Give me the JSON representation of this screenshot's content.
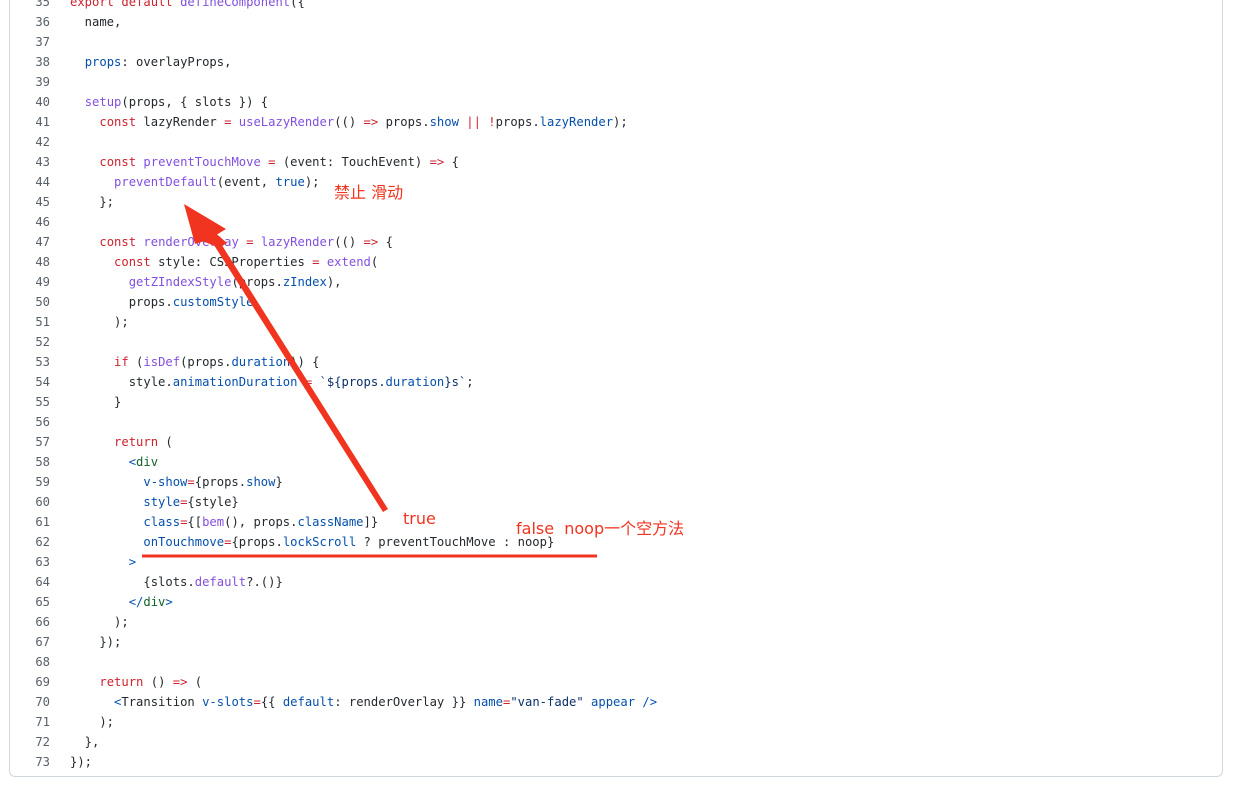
{
  "code": {
    "lines": [
      {
        "n": "35",
        "tokens": [
          {
            "t": "export default ",
            "c": "k"
          },
          {
            "t": "defineComponent",
            "c": "f"
          },
          {
            "t": "({",
            "c": "p"
          }
        ]
      },
      {
        "n": "36",
        "tokens": [
          {
            "t": "  name,",
            "c": "p"
          }
        ]
      },
      {
        "n": "37",
        "tokens": []
      },
      {
        "n": "38",
        "tokens": [
          {
            "t": "  ",
            "c": "p"
          },
          {
            "t": "props",
            "c": "c"
          },
          {
            "t": ": overlayProps,",
            "c": "p"
          }
        ]
      },
      {
        "n": "39",
        "tokens": []
      },
      {
        "n": "40",
        "tokens": [
          {
            "t": "  ",
            "c": "p"
          },
          {
            "t": "setup",
            "c": "f"
          },
          {
            "t": "(props, { slots }) {",
            "c": "p"
          }
        ]
      },
      {
        "n": "41",
        "tokens": [
          {
            "t": "    ",
            "c": "p"
          },
          {
            "t": "const ",
            "c": "k"
          },
          {
            "t": "lazyRender ",
            "c": "p"
          },
          {
            "t": "= ",
            "c": "k"
          },
          {
            "t": "useLazyRender",
            "c": "f"
          },
          {
            "t": "(() ",
            "c": "p"
          },
          {
            "t": "=> ",
            "c": "k"
          },
          {
            "t": "props.",
            "c": "p"
          },
          {
            "t": "show ",
            "c": "c"
          },
          {
            "t": "|| ",
            "c": "k"
          },
          {
            "t": "!",
            "c": "k"
          },
          {
            "t": "props.",
            "c": "p"
          },
          {
            "t": "lazyRender",
            "c": "c"
          },
          {
            "t": ");",
            "c": "p"
          }
        ]
      },
      {
        "n": "42",
        "tokens": []
      },
      {
        "n": "43",
        "tokens": [
          {
            "t": "    ",
            "c": "p"
          },
          {
            "t": "const ",
            "c": "k"
          },
          {
            "t": "preventTouchMove ",
            "c": "f"
          },
          {
            "t": "= ",
            "c": "k"
          },
          {
            "t": "(event: TouchEvent) ",
            "c": "p"
          },
          {
            "t": "=> ",
            "c": "k"
          },
          {
            "t": "{",
            "c": "p"
          }
        ]
      },
      {
        "n": "44",
        "tokens": [
          {
            "t": "      ",
            "c": "p"
          },
          {
            "t": "preventDefault",
            "c": "f"
          },
          {
            "t": "(event, ",
            "c": "p"
          },
          {
            "t": "true",
            "c": "c"
          },
          {
            "t": ");",
            "c": "p"
          }
        ]
      },
      {
        "n": "45",
        "tokens": [
          {
            "t": "    };",
            "c": "p"
          }
        ]
      },
      {
        "n": "46",
        "tokens": []
      },
      {
        "n": "47",
        "tokens": [
          {
            "t": "    ",
            "c": "p"
          },
          {
            "t": "const ",
            "c": "k"
          },
          {
            "t": "renderOverlay ",
            "c": "f"
          },
          {
            "t": "= ",
            "c": "k"
          },
          {
            "t": "lazyRender",
            "c": "f"
          },
          {
            "t": "(() ",
            "c": "p"
          },
          {
            "t": "=> ",
            "c": "k"
          },
          {
            "t": "{",
            "c": "p"
          }
        ]
      },
      {
        "n": "48",
        "tokens": [
          {
            "t": "      ",
            "c": "p"
          },
          {
            "t": "const ",
            "c": "k"
          },
          {
            "t": "style: CSSProperties ",
            "c": "p"
          },
          {
            "t": "= ",
            "c": "k"
          },
          {
            "t": "extend",
            "c": "f"
          },
          {
            "t": "(",
            "c": "p"
          }
        ]
      },
      {
        "n": "49",
        "tokens": [
          {
            "t": "        ",
            "c": "p"
          },
          {
            "t": "getZIndexStyle",
            "c": "f"
          },
          {
            "t": "(props.",
            "c": "p"
          },
          {
            "t": "zIndex",
            "c": "c"
          },
          {
            "t": "),",
            "c": "p"
          }
        ]
      },
      {
        "n": "50",
        "tokens": [
          {
            "t": "        props.",
            "c": "p"
          },
          {
            "t": "customStyle",
            "c": "c"
          }
        ]
      },
      {
        "n": "51",
        "tokens": [
          {
            "t": "      );",
            "c": "p"
          }
        ]
      },
      {
        "n": "52",
        "tokens": []
      },
      {
        "n": "53",
        "tokens": [
          {
            "t": "      ",
            "c": "p"
          },
          {
            "t": "if ",
            "c": "k"
          },
          {
            "t": "(",
            "c": "p"
          },
          {
            "t": "isDef",
            "c": "f"
          },
          {
            "t": "(props.",
            "c": "p"
          },
          {
            "t": "duration",
            "c": "c"
          },
          {
            "t": ")) {",
            "c": "p"
          }
        ]
      },
      {
        "n": "54",
        "tokens": [
          {
            "t": "        style.",
            "c": "p"
          },
          {
            "t": "animationDuration ",
            "c": "c"
          },
          {
            "t": "= ",
            "c": "k"
          },
          {
            "t": "`${props.",
            "c": "s"
          },
          {
            "t": "duration",
            "c": "c"
          },
          {
            "t": "}s`",
            "c": "s"
          },
          {
            "t": ";",
            "c": "p"
          }
        ]
      },
      {
        "n": "55",
        "tokens": [
          {
            "t": "      }",
            "c": "p"
          }
        ]
      },
      {
        "n": "56",
        "tokens": []
      },
      {
        "n": "57",
        "tokens": [
          {
            "t": "      ",
            "c": "p"
          },
          {
            "t": "return ",
            "c": "k"
          },
          {
            "t": "(",
            "c": "p"
          }
        ]
      },
      {
        "n": "58",
        "tokens": [
          {
            "t": "        <",
            "c": "c"
          },
          {
            "t": "div",
            "c": "t"
          }
        ]
      },
      {
        "n": "59",
        "tokens": [
          {
            "t": "          ",
            "c": "p"
          },
          {
            "t": "v-show",
            "c": "c"
          },
          {
            "t": "=",
            "c": "k"
          },
          {
            "t": "{props.",
            "c": "p"
          },
          {
            "t": "show",
            "c": "c"
          },
          {
            "t": "}",
            "c": "p"
          }
        ]
      },
      {
        "n": "60",
        "tokens": [
          {
            "t": "          ",
            "c": "p"
          },
          {
            "t": "style",
            "c": "c"
          },
          {
            "t": "=",
            "c": "k"
          },
          {
            "t": "{style}",
            "c": "p"
          }
        ]
      },
      {
        "n": "61",
        "tokens": [
          {
            "t": "          ",
            "c": "p"
          },
          {
            "t": "class",
            "c": "c"
          },
          {
            "t": "=",
            "c": "k"
          },
          {
            "t": "{[",
            "c": "p"
          },
          {
            "t": "bem",
            "c": "f"
          },
          {
            "t": "(), props.",
            "c": "p"
          },
          {
            "t": "className",
            "c": "c"
          },
          {
            "t": "]}",
            "c": "p"
          }
        ]
      },
      {
        "n": "62",
        "tokens": [
          {
            "t": "          ",
            "c": "p"
          },
          {
            "t": "onTouchmove",
            "c": "c"
          },
          {
            "t": "=",
            "c": "k"
          },
          {
            "t": "{props.",
            "c": "p"
          },
          {
            "t": "lockScroll ",
            "c": "c"
          },
          {
            "t": "? preventTouchMove : noop}",
            "c": "p"
          }
        ]
      },
      {
        "n": "63",
        "tokens": [
          {
            "t": "        >",
            "c": "c"
          }
        ]
      },
      {
        "n": "64",
        "tokens": [
          {
            "t": "          {slots.",
            "c": "p"
          },
          {
            "t": "default",
            "c": "f"
          },
          {
            "t": "?.()}",
            "c": "p"
          }
        ]
      },
      {
        "n": "65",
        "tokens": [
          {
            "t": "        </",
            "c": "c"
          },
          {
            "t": "div",
            "c": "t"
          },
          {
            "t": ">",
            "c": "c"
          }
        ]
      },
      {
        "n": "66",
        "tokens": [
          {
            "t": "      );",
            "c": "p"
          }
        ]
      },
      {
        "n": "67",
        "tokens": [
          {
            "t": "    });",
            "c": "p"
          }
        ]
      },
      {
        "n": "68",
        "tokens": []
      },
      {
        "n": "69",
        "tokens": [
          {
            "t": "    ",
            "c": "p"
          },
          {
            "t": "return ",
            "c": "k"
          },
          {
            "t": "() ",
            "c": "p"
          },
          {
            "t": "=> ",
            "c": "k"
          },
          {
            "t": "(",
            "c": "p"
          }
        ]
      },
      {
        "n": "70",
        "tokens": [
          {
            "t": "      <",
            "c": "c"
          },
          {
            "t": "Transition ",
            "c": "p"
          },
          {
            "t": "v-slots",
            "c": "c"
          },
          {
            "t": "=",
            "c": "k"
          },
          {
            "t": "{{ ",
            "c": "p"
          },
          {
            "t": "default",
            "c": "c"
          },
          {
            "t": ": renderOverlay }} ",
            "c": "p"
          },
          {
            "t": "name",
            "c": "c"
          },
          {
            "t": "=",
            "c": "k"
          },
          {
            "t": "\"van-fade\" ",
            "c": "s"
          },
          {
            "t": "appear ",
            "c": "c"
          },
          {
            "t": "/>",
            "c": "c"
          }
        ]
      },
      {
        "n": "71",
        "tokens": [
          {
            "t": "    );",
            "c": "p"
          }
        ]
      },
      {
        "n": "72",
        "tokens": [
          {
            "t": "  },",
            "c": "p"
          }
        ]
      },
      {
        "n": "73",
        "tokens": [
          {
            "t": "});",
            "c": "p"
          }
        ]
      }
    ]
  },
  "annotations": {
    "disable_scroll": "禁止 滑动",
    "true_label": "true",
    "false_label": "false  noop一个空方法",
    "color": "#f0341f"
  }
}
